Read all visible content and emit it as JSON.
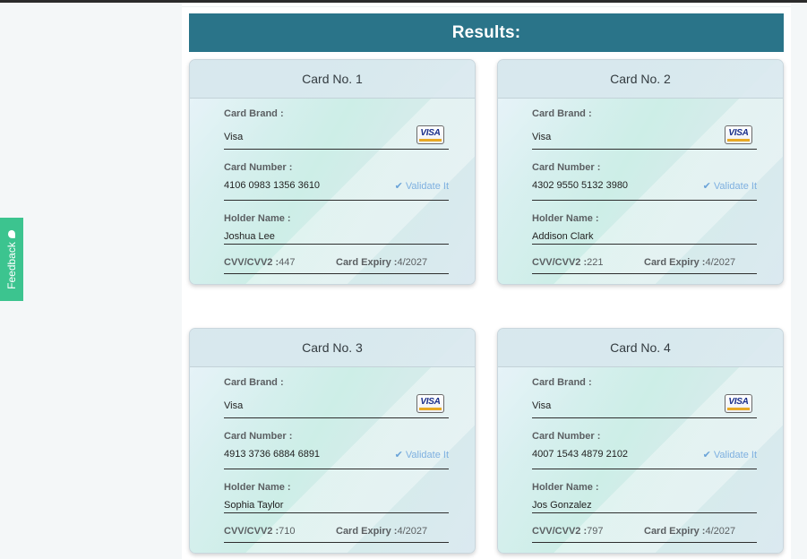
{
  "header": {
    "title": "Results:"
  },
  "feedback": {
    "label": "Feedback",
    "icon": "chat-bubble-icon"
  },
  "labels": {
    "brand": "Card Brand :",
    "number": "Card Number :",
    "holder": "Holder Name :",
    "cvv": "CVV/CVV2 :",
    "expiry": "Card Expiry :",
    "validate": "Validate It",
    "validate_icon": "✔"
  },
  "colors": {
    "header_bg": "#2a7489",
    "feedback_bg": "#3cc48f",
    "validate": "#7eb0e0"
  },
  "cards": [
    {
      "title": "Card No. 1",
      "brand": "Visa",
      "brand_logo": "VISA",
      "number": "4106 0983 1356 3610",
      "holder": "Joshua Lee",
      "cvv": "447",
      "expiry": "4/2027"
    },
    {
      "title": "Card No. 2",
      "brand": "Visa",
      "brand_logo": "VISA",
      "number": "4302 9550 5132 3980",
      "holder": "Addison Clark",
      "cvv": "221",
      "expiry": "4/2027"
    },
    {
      "title": "Card No. 3",
      "brand": "Visa",
      "brand_logo": "VISA",
      "number": "4913 3736 6884 6891",
      "holder": "Sophia Taylor",
      "cvv": "710",
      "expiry": "4/2027"
    },
    {
      "title": "Card No. 4",
      "brand": "Visa",
      "brand_logo": "VISA",
      "number": "4007 1543 4879 2102",
      "holder": "Jos Gonzalez",
      "cvv": "797",
      "expiry": "4/2027"
    }
  ]
}
